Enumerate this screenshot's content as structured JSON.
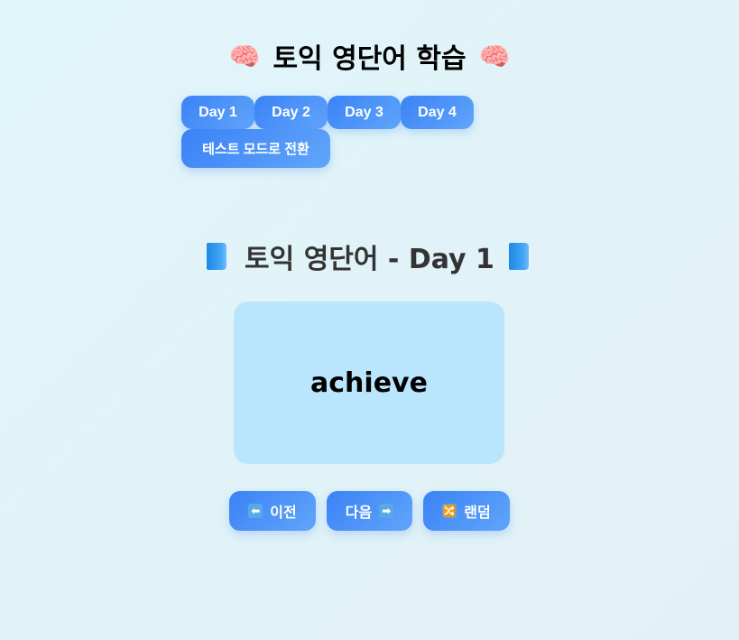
{
  "header": {
    "title": "토익 영단어 학습",
    "left_icon": "brain-icon",
    "right_icon": "brain-icon"
  },
  "day_tabs": [
    {
      "label": "Day 1"
    },
    {
      "label": "Day 2"
    },
    {
      "label": "Day 3"
    },
    {
      "label": "Day 4"
    }
  ],
  "mode_toggle": {
    "label": "테스트 모드로 전환"
  },
  "section": {
    "title": "토익 영단어 - Day 1",
    "icon": "book-icon"
  },
  "card": {
    "word": "achieve"
  },
  "controls": {
    "prev": {
      "label": "이전",
      "icon": "left-arrow-icon",
      "glyph": "⬅"
    },
    "next": {
      "label": "다음",
      "icon": "right-arrow-icon",
      "glyph": "➡"
    },
    "random": {
      "label": "랜덤",
      "icon": "shuffle-icon",
      "glyph": "🔀"
    }
  },
  "colors": {
    "button_start": "#3b82f6",
    "button_end": "#60a5fa",
    "card_bg": "#bae6fd",
    "page_bg": "#e0f5fa"
  }
}
